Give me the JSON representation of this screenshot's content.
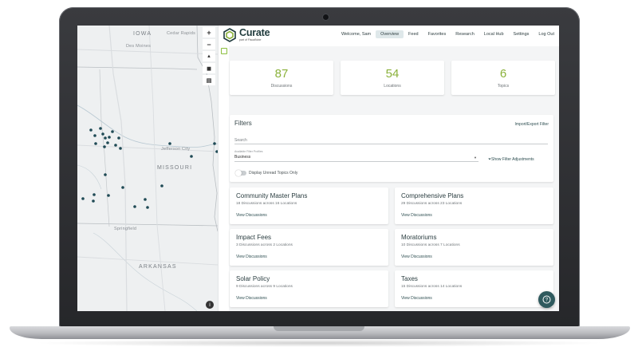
{
  "app": {
    "brand_name": "Curate",
    "brand_sub": "part of FiscalNote"
  },
  "nav": {
    "welcome": "Welcome, Sam",
    "items": [
      {
        "label": "Overview",
        "active": true
      },
      {
        "label": "Feed",
        "active": false
      },
      {
        "label": "Favorites",
        "active": false
      },
      {
        "label": "Research",
        "active": false
      },
      {
        "label": "Local Hub",
        "active": false
      },
      {
        "label": "Settings",
        "active": false
      },
      {
        "label": "Log Out",
        "active": false
      }
    ]
  },
  "stats": [
    {
      "value": "87",
      "label": "Discussions"
    },
    {
      "value": "54",
      "label": "Locations"
    },
    {
      "value": "6",
      "label": "Topics"
    }
  ],
  "filters": {
    "title": "Filters",
    "import_export": "Import/Export Filter",
    "search_placeholder": "Search",
    "profile_label": "Available Filter Profiles",
    "profile_value": "Business",
    "show_adjustments": "Show Filter Adjustments",
    "unread_toggle_label": "Display Unread Topics Only",
    "unread_toggle_on": false
  },
  "topics": [
    {
      "title": "Community Master Plans",
      "meta": "18 Discussions across 16 Locations",
      "link": "View Discussions"
    },
    {
      "title": "Comprehensive Plans",
      "meta": "29 Discussions across 23 Locations",
      "link": "View Discussions"
    },
    {
      "title": "Impact Fees",
      "meta": "3 Discussions across 2 Locations",
      "link": "View Discussions"
    },
    {
      "title": "Moratoriums",
      "meta": "10 Discussions across 7 Locations",
      "link": "View Discussions"
    },
    {
      "title": "Solar Policy",
      "meta": "9 Discussions across 9 Locations",
      "link": "View Discussions"
    },
    {
      "title": "Taxes",
      "meta": "15 Discussions across 14 Locations",
      "link": "View Discussions"
    }
  ],
  "map": {
    "labels": {
      "iowa": "IOWA",
      "cedar_rapids": "Cedar Rapids",
      "des_moines": "Des Moines",
      "jefferson_city": "Jefferson City",
      "missouri": "MISSOURI",
      "springfield": "Springfield",
      "arkansas": "ARKANSAS"
    },
    "controls": [
      "+",
      "−",
      "▲",
      "◼",
      "▤"
    ]
  },
  "colors": {
    "accent_green": "#8ab13a",
    "dark_teal": "#2f5a5e",
    "map_pin": "#1f4a55"
  }
}
